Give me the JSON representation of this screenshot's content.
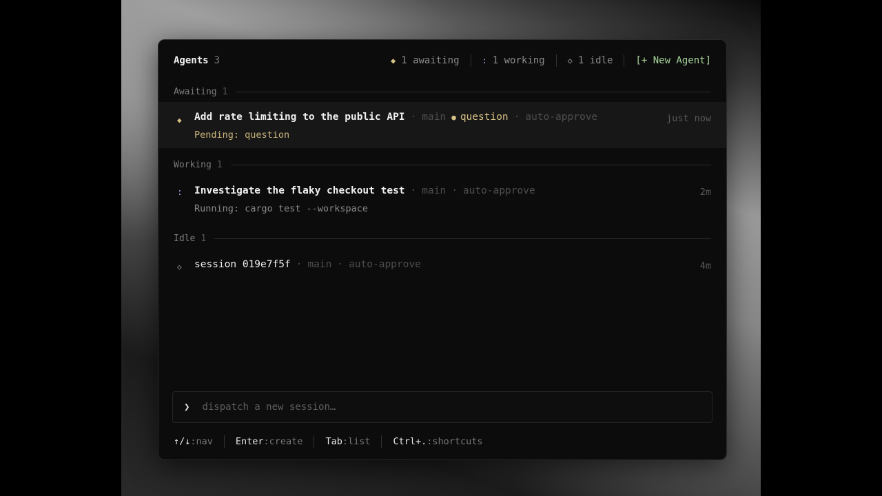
{
  "header": {
    "title": "Agents",
    "count": "3",
    "stats": [
      {
        "glyph": "◆",
        "label": "1 awaiting"
      },
      {
        "glyph": ":",
        "label": "1 working"
      },
      {
        "glyph": "◇",
        "label": "1 idle"
      }
    ],
    "new_agent_label": "[+ New Agent]"
  },
  "sections": {
    "awaiting": {
      "label": "Awaiting",
      "count": "1",
      "item": {
        "glyph": "◆",
        "name": "Add rate limiting to the public API",
        "branch": "main",
        "status": "question",
        "policy": "auto-approve",
        "time": "just now",
        "sub": "Pending: question"
      }
    },
    "working": {
      "label": "Working",
      "count": "1",
      "item": {
        "glyph": ":",
        "name": "Investigate the flaky checkout test",
        "branch": "main",
        "policy": "auto-approve",
        "time": "2m",
        "sub": "Running: cargo test --workspace"
      }
    },
    "idle": {
      "label": "Idle",
      "count": "1",
      "item": {
        "glyph": "◇",
        "name": "session 019e7f5f",
        "branch": "main",
        "policy": "auto-approve",
        "time": "4m"
      }
    }
  },
  "input": {
    "prompt": "❯",
    "placeholder": "dispatch a new session…"
  },
  "footer": {
    "hints": [
      {
        "key": "↑/↓",
        "action": ":nav"
      },
      {
        "key": "Enter",
        "action": ":create"
      },
      {
        "key": "Tab",
        "action": ":list"
      },
      {
        "key": "Ctrl+.",
        "action": ":shortcuts"
      }
    ]
  },
  "separator": "·",
  "status_dot": "●",
  "colors": {
    "awaiting": "#d6c186",
    "working": "#8fa0d6",
    "new_agent": "#a6d39a",
    "panel_bg": "#0c0c0c"
  }
}
